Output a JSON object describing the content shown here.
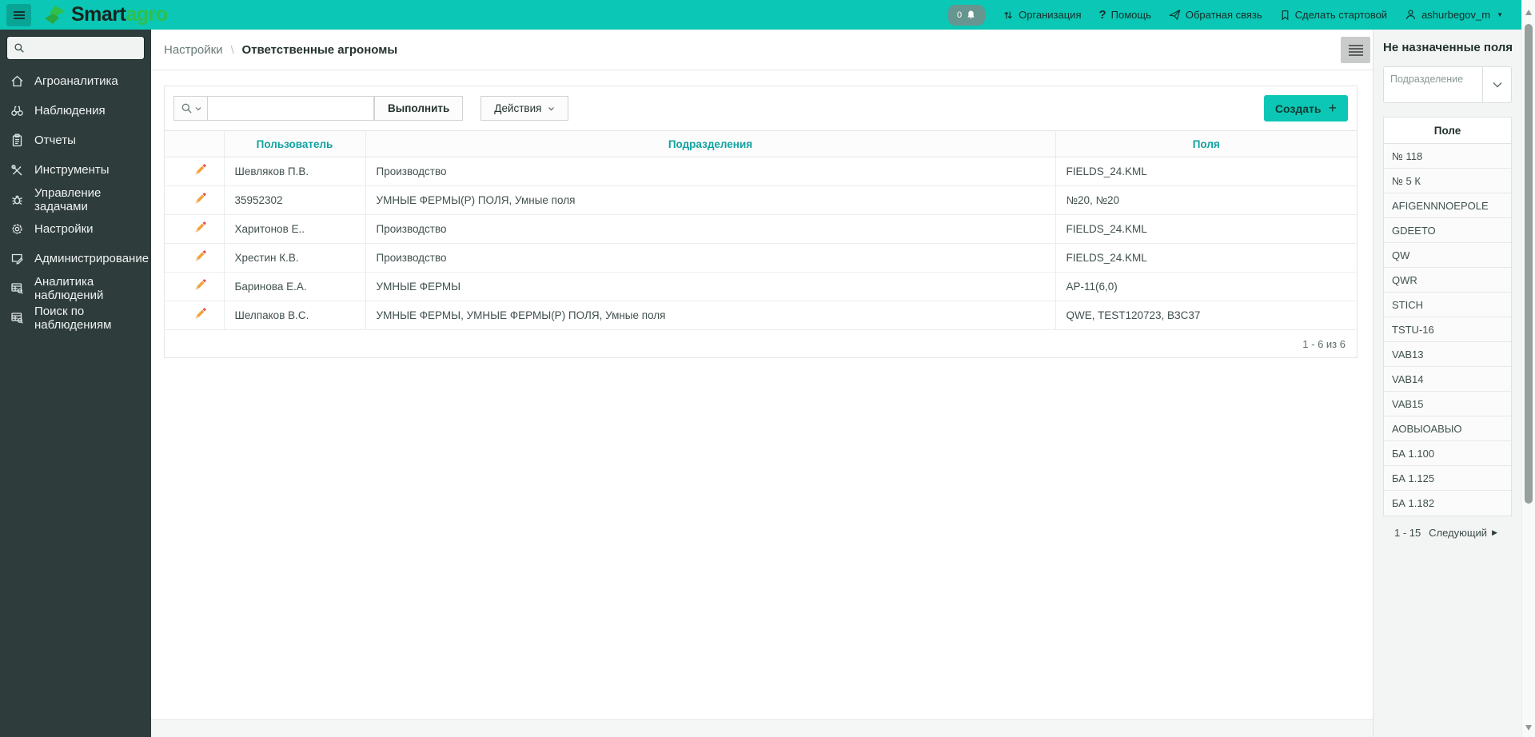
{
  "header": {
    "logo_smart": "Smart",
    "logo_agro": "agro",
    "notification_count": "0",
    "links": [
      {
        "label": "Организация",
        "icon": "swap-arrows-icon"
      },
      {
        "label": "Помощь",
        "icon": "question-icon"
      },
      {
        "label": "Обратная связь",
        "icon": "paper-plane-icon"
      },
      {
        "label": "Сделать стартовой",
        "icon": "bookmark-icon"
      },
      {
        "label": "ashurbegov_m",
        "icon": "user-icon"
      }
    ],
    "user_caret": "▼"
  },
  "sidebar": {
    "search_value": "",
    "items": [
      {
        "label": "Агроаналитика",
        "icon": "home-icon"
      },
      {
        "label": "Наблюдения",
        "icon": "binoculars-icon"
      },
      {
        "label": "Отчеты",
        "icon": "report-icon"
      },
      {
        "label": "Инструменты",
        "icon": "tools-icon"
      },
      {
        "label": "Управление задачами",
        "icon": "bug-icon"
      },
      {
        "label": "Настройки",
        "icon": "gear-icon"
      },
      {
        "label": "Администрирование",
        "icon": "admin-icon"
      },
      {
        "label": "Аналитика наблюдений",
        "icon": "table-search-icon"
      },
      {
        "label": "Поиск по наблюдениям",
        "icon": "table-search-icon"
      }
    ]
  },
  "breadcrumb": {
    "parent": "Настройки",
    "separator": "\\",
    "current": "Ответственные агрономы"
  },
  "toolbar": {
    "search_value": "",
    "run_label": "Выполнить",
    "actions_label": "Действия",
    "create_label": "Создать",
    "create_plus": "+"
  },
  "table": {
    "columns": [
      "Пользователь",
      "Подразделения",
      "Поля"
    ],
    "rows": [
      {
        "user": "Шевляков П.В.",
        "departments": "Производство",
        "fields": "FIELDS_24.KML"
      },
      {
        "user": "35952302",
        "departments": "УМНЫЕ ФЕРМЫ(Р) ПОЛЯ, Умные поля",
        "fields": "№20, №20"
      },
      {
        "user": "Харитонов Е..",
        "departments": "Производство",
        "fields": "FIELDS_24.KML"
      },
      {
        "user": "Хрестин К.В.",
        "departments": "Производство",
        "fields": "FIELDS_24.KML"
      },
      {
        "user": "Баринова Е.А.",
        "departments": "УМНЫЕ ФЕРМЫ",
        "fields": "АР-11(6,0)"
      },
      {
        "user": "Шелпаков В.С.",
        "departments": "УМНЫЕ ФЕРМЫ, УМНЫЕ ФЕРМЫ(Р) ПОЛЯ, Умные поля",
        "fields": "QWE, TEST120723, ВЗС37"
      }
    ],
    "pagination": "1 - 6 из 6"
  },
  "right_panel": {
    "title": "Не назначенные поля",
    "filter_placeholder": "Подразделение",
    "list_header": "Поле",
    "items": [
      "№ 118",
      "№ 5 К",
      "AFIGENNNOEPOLE",
      "GDEETO",
      "QW",
      "QWR",
      "STICH",
      "TSTU-16",
      "VAB13",
      "VAB14",
      "VAB15",
      "АОВЫОАВЫО",
      "БА 1.100",
      "БА 1.125",
      "БА 1.182"
    ],
    "pagination": "1 - 15",
    "next_label": "Следующий",
    "next_arrow": "▶"
  },
  "colors": {
    "header_teal": "#0bc7b5",
    "sidebar_dark": "#2e3c3b",
    "logo_green": "#2fbf4a",
    "table_header_teal": "#12a2a1",
    "create_button_teal": "#0cc7b5",
    "pencil_orange": "#f2a33c",
    "pencil_red": "#e2574c"
  }
}
